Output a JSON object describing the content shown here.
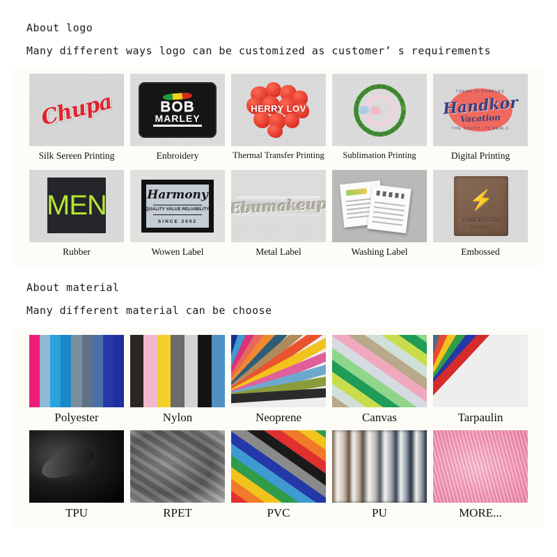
{
  "logo_section": {
    "heading": "About logo",
    "subheading": "Many different ways logo can be customized as customer’ s requirements",
    "items": [
      {
        "caption": "Silk Sereen Printing",
        "art": {
          "text": "Chupa"
        }
      },
      {
        "caption": "Enbroidery",
        "art": {
          "line1": "BOB",
          "line2": "MARLEY",
          "tm": "™"
        }
      },
      {
        "caption": "Thermal Transfer Printing",
        "art": {
          "text": "HERRY LOV"
        }
      },
      {
        "caption": "Sublimation Printing",
        "art": {
          "text": ""
        }
      },
      {
        "caption": "Digital Printing",
        "art": {
          "top": "THERE IS PURPLES",
          "name": "Handkor",
          "sub": "Vacation",
          "bottom": "THE SOUTH ITS REALS"
        }
      },
      {
        "caption": "Rubber",
        "art": {
          "text": "MEN"
        }
      },
      {
        "caption": "Wowen Label",
        "art": {
          "name": "Harmony",
          "quality": "QUALITY VALUE RELIABILITY",
          "since": "SINCE 2002"
        }
      },
      {
        "caption": "Metal Label",
        "art": {
          "text": "Ebumakeup"
        }
      },
      {
        "caption": "Washing Label",
        "art": {
          "text": ""
        }
      },
      {
        "caption": "Embossed",
        "art": {
          "mark": "⚡",
          "name": "EMERSON",
          "sub": "APPAREL"
        }
      }
    ]
  },
  "material_section": {
    "heading": "About material",
    "subheading": "Many different material can be choose",
    "items": [
      {
        "label": "Polyester",
        "colors": [
          "#ec1d74",
          "#8fb8d6",
          "#29a3dd",
          "#1b86c8",
          "#7b8e9e",
          "#5e7287",
          "#4a6fa8",
          "#2438a8",
          "#1f2fa0"
        ]
      },
      {
        "label": "Nylon",
        "colors": [
          "#2b2623",
          "#f0b9cc",
          "#f3cf2a",
          "#6b6b6b",
          "#cfd3d6",
          "#141414",
          "#4d91c4"
        ]
      },
      {
        "label": "Neoprene",
        "colors": [
          "#1b2f8f",
          "#3f9ad1",
          "#d6337a",
          "#e8685c",
          "#f08a2e",
          "#2f5d78",
          "#b08a5c",
          "#e9542f",
          "#f2c21d",
          "#e0609a",
          "#6fa8cf",
          "#8a9c3b",
          "#2b2b2b"
        ]
      },
      {
        "label": "Canvas",
        "colors": [
          "#b9a88a",
          "#cfe0d8",
          "#c8dd4b",
          "#1f9c58",
          "#8fd68a",
          "#d5dbe0",
          "#f0a8bf"
        ]
      },
      {
        "label": "Tarpaulin",
        "colors": [
          "#4a6a86",
          "#e84a2f",
          "#f2c21d",
          "#2f9c4a",
          "#2438a8",
          "#d62b2b"
        ]
      },
      {
        "label": "TPU",
        "colors": [
          "#1a1a1a",
          "#2e2e2e",
          "#000000"
        ]
      },
      {
        "label": "RPET",
        "colors": [
          "#8a8a8a",
          "#5a5a5a",
          "#b5b5b5"
        ]
      },
      {
        "label": "PVC",
        "colors": [
          "#e03030",
          "#f07a2a",
          "#f2c21d",
          "#2f9c4a",
          "#3f9ad1",
          "#2438a8",
          "#8a8a8a",
          "#1a1a1a"
        ]
      },
      {
        "label": "PU",
        "colors": [
          "#b79d7e",
          "#8a7257",
          "#9b9b97",
          "#6f7d8c",
          "#4a5a6e",
          "#3f4a5a"
        ]
      },
      {
        "label": "MORE...",
        "colors": [
          "#f2a0bc",
          "#e87fa6",
          "#f7c2d4"
        ]
      }
    ]
  }
}
